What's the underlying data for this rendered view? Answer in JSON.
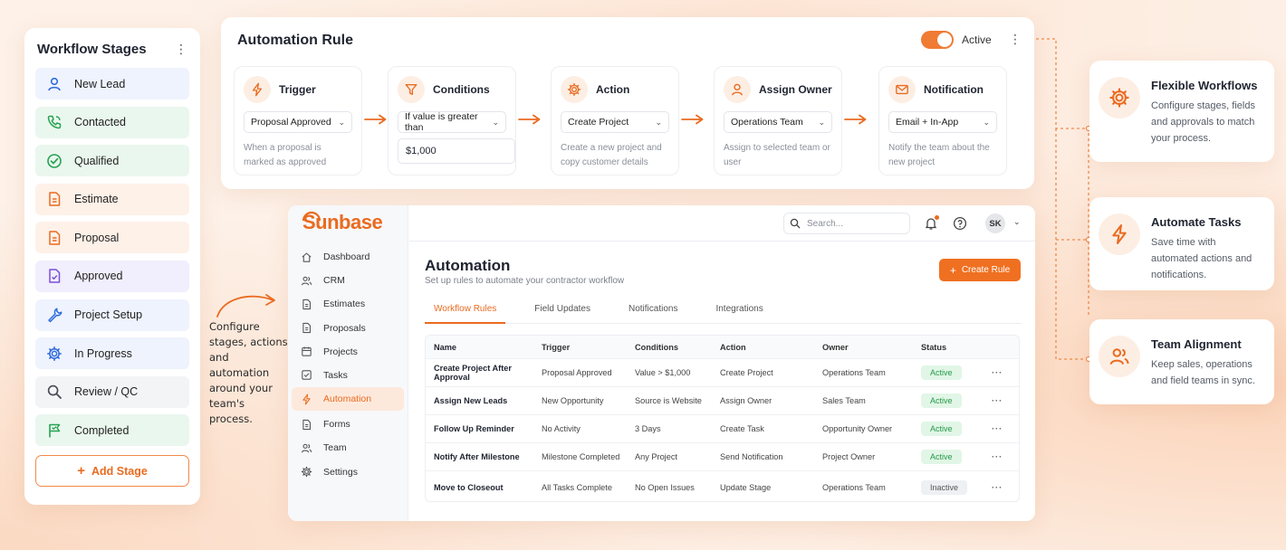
{
  "stages": {
    "title": "Workflow Stages",
    "items": [
      {
        "label": "New Lead",
        "icon": "user-icon",
        "bg": "#eef3fd",
        "color": "#2f6bdc"
      },
      {
        "label": "Contacted",
        "icon": "phone-icon",
        "bg": "#eaf7ee",
        "color": "#27a252"
      },
      {
        "label": "Qualified",
        "icon": "check-circle-icon",
        "bg": "#eaf7ee",
        "color": "#27a252"
      },
      {
        "label": "Estimate",
        "icon": "document-icon",
        "bg": "#fef1e8",
        "color": "#ea6b20"
      },
      {
        "label": "Proposal",
        "icon": "document-icon",
        "bg": "#fef1e8",
        "color": "#ea6b20"
      },
      {
        "label": "Approved",
        "icon": "document-check-icon",
        "bg": "#f1eefd",
        "color": "#7a4fdc"
      },
      {
        "label": "Project Setup",
        "icon": "wrench-icon",
        "bg": "#eef3fd",
        "color": "#2f6bdc"
      },
      {
        "label": "In Progress",
        "icon": "gear-icon",
        "bg": "#eef3fd",
        "color": "#2f6bdc"
      },
      {
        "label": "Review / QC",
        "icon": "magnifier-icon",
        "bg": "#f3f4f6",
        "color": "#444a55"
      },
      {
        "label": "Completed",
        "icon": "flag-icon",
        "bg": "#eaf7ee",
        "color": "#27a252"
      }
    ],
    "add_label": "Add Stage"
  },
  "rule": {
    "title": "Automation Rule",
    "status": "Active",
    "steps": [
      {
        "name": "Trigger",
        "icon": "lightning-icon",
        "select": "Proposal Approved",
        "desc": "When a proposal is marked as approved"
      },
      {
        "name": "Conditions",
        "icon": "funnel-icon",
        "select": "If value is greater than",
        "value": "$1,000",
        "desc": ""
      },
      {
        "name": "Action",
        "icon": "gear-icon",
        "select": "Create Project",
        "desc": "Create a new project and copy customer details"
      },
      {
        "name": "Assign Owner",
        "icon": "user-icon",
        "select": "Operations Team",
        "desc": "Assign to selected team or user"
      },
      {
        "name": "Notification",
        "icon": "envelope-icon",
        "select": "Email + In-App",
        "desc": "Notify the team about the new project"
      }
    ]
  },
  "features": [
    {
      "title": "Flexible Workflows",
      "desc": "Configure stages, fields and approvals to match your process.",
      "icon": "gear-icon"
    },
    {
      "title": "Automate Tasks",
      "desc": "Save time with automated actions and notifications.",
      "icon": "lightning-icon"
    },
    {
      "title": "Team Alignment",
      "desc": "Keep sales, operations and field teams in sync.",
      "icon": "users-icon"
    }
  ],
  "note": "Configure stages, actions and automation around your team's process.",
  "app": {
    "brand": "Sunbase",
    "nav": [
      {
        "label": "Dashboard",
        "icon": "home-icon"
      },
      {
        "label": "CRM",
        "icon": "users-icon"
      },
      {
        "label": "Estimates",
        "icon": "document-icon"
      },
      {
        "label": "Proposals",
        "icon": "document-icon"
      },
      {
        "label": "Projects",
        "icon": "calendar-icon"
      },
      {
        "label": "Tasks",
        "icon": "checkbox-icon"
      },
      {
        "label": "Automation",
        "icon": "lightning-icon",
        "selected": true
      },
      {
        "label": "Forms",
        "icon": "document-icon"
      },
      {
        "label": "Team",
        "icon": "users-icon"
      },
      {
        "label": "Settings",
        "icon": "gear-icon"
      }
    ],
    "search_placeholder": "Search...",
    "avatar": "SK",
    "title": "Automation",
    "subtitle": "Set up rules to automate your contractor workflow",
    "create_label": "Create Rule",
    "tabs": [
      "Workflow Rules",
      "Field Updates",
      "Notifications",
      "Integrations"
    ],
    "active_tab": "Workflow Rules",
    "columns": [
      "Name",
      "Trigger",
      "Conditions",
      "Action",
      "Owner",
      "Status"
    ],
    "rows": [
      {
        "name": "Create Project After Approval",
        "trigger": "Proposal Approved",
        "conditions": "Value > $1,000",
        "action": "Create Project",
        "owner": "Operations Team",
        "status": "Active"
      },
      {
        "name": "Assign New Leads",
        "trigger": "New Opportunity",
        "conditions": "Source is Website",
        "action": "Assign Owner",
        "owner": "Sales Team",
        "status": "Active"
      },
      {
        "name": "Follow Up Reminder",
        "trigger": "No Activity",
        "conditions": "3 Days",
        "action": "Create Task",
        "owner": "Opportunity Owner",
        "status": "Active"
      },
      {
        "name": "Notify After Milestone",
        "trigger": "Milestone Completed",
        "conditions": "Any Project",
        "action": "Send Notification",
        "owner": "Project Owner",
        "status": "Active"
      },
      {
        "name": "Move to Closeout",
        "trigger": "All Tasks Complete",
        "conditions": "No Open Issues",
        "action": "Update Stage",
        "owner": "Operations Team",
        "status": "Inactive"
      }
    ]
  },
  "colors": {
    "accent": "#ea6b20",
    "active_green": "#259a4a"
  }
}
